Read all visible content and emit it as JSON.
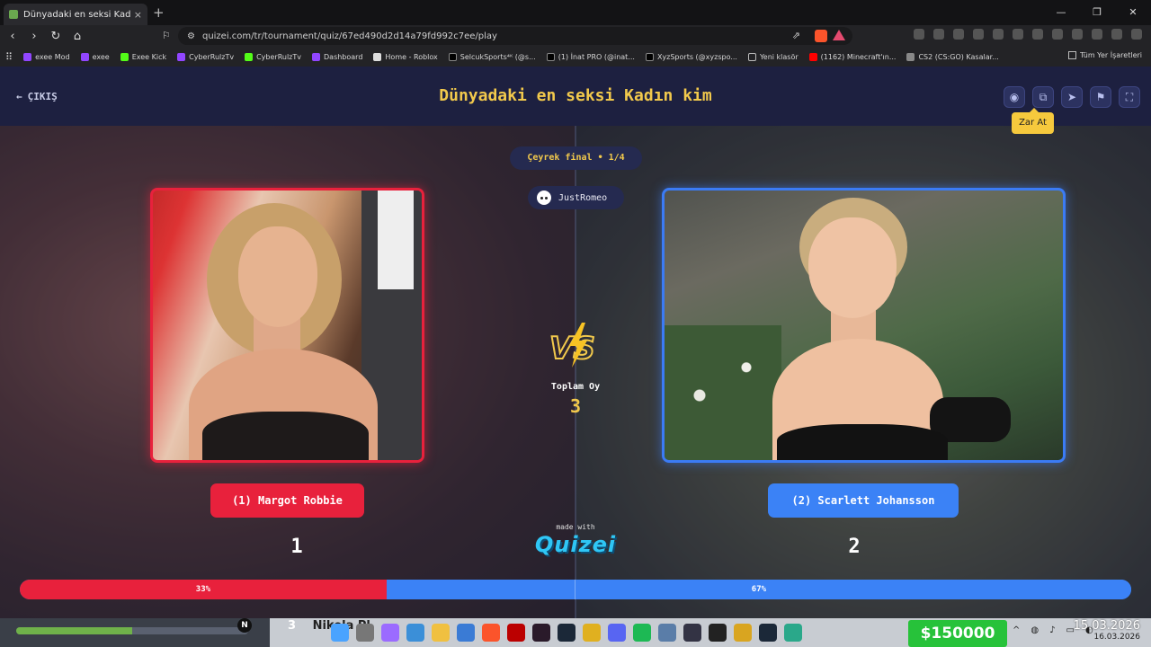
{
  "browser": {
    "tab_title": "Dünyadaki en seksi Kadın kim -",
    "tab_close": "×",
    "new_tab": "+",
    "url": "quizei.com/tr/tournament/quiz/67ed490d2d14a79fd992c7ee/play",
    "bookmarks": [
      "exee Mod",
      "exee",
      "Exee Kick",
      "CyberRulzTv",
      "CyberRulzTv",
      "Dashboard",
      "Home - Roblox",
      "SelcukSports⁴ᴷ (@s...",
      "(1) İnat PRO (@inat...",
      "XyzSports (@xyzspo...",
      "Yeni klasör",
      "(1162) Minecraft'ın...",
      "CS2 (CS:GO) Kasalar..."
    ],
    "bookmarks_right": "Tüm Yer İşaretleri"
  },
  "header": {
    "exit_label": "ÇIKIŞ",
    "title": "Dünyadaki en seksi Kadın kim",
    "tooltip": "Zar At"
  },
  "match": {
    "round_label": "Çeyrek final • 1/4",
    "user": "JustRomeo",
    "total_label": "Toplam Oy",
    "total_votes": "3",
    "left": {
      "name": "(1) Margot Robbie",
      "votes": "1",
      "percent_label": "33%",
      "color": "#e8213c"
    },
    "right": {
      "name": "(2) Scarlett Johansson",
      "votes": "2",
      "percent_label": "67%",
      "color": "#3b82f6"
    },
    "left_share": 0.33
  },
  "branding": {
    "made_with": "made with",
    "logo": "Quizei"
  },
  "taskbar": {
    "n_badge": "N",
    "left_text": "3",
    "app_text": "Nikola Pl",
    "money": "$150000",
    "date_big": "15.03.2026",
    "date_small": "16.03.2026"
  }
}
